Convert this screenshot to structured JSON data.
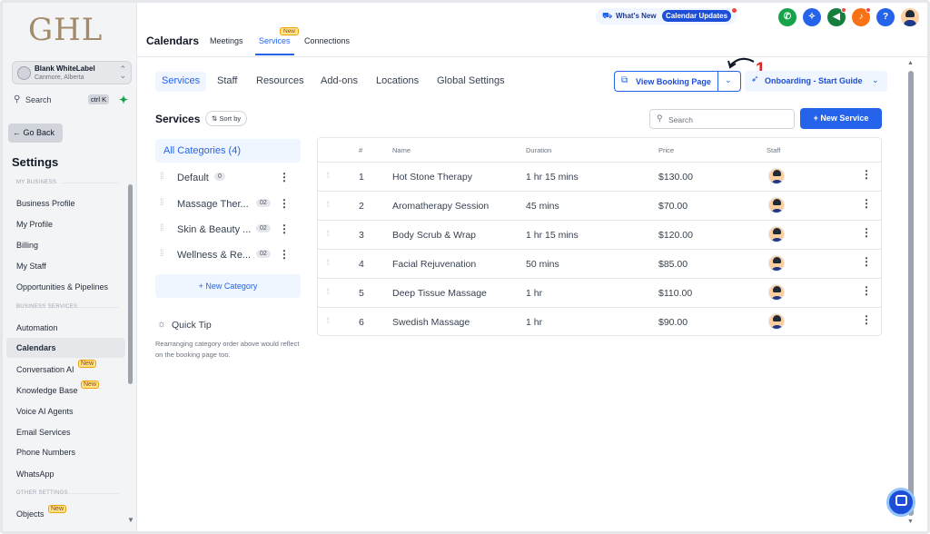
{
  "sidebar": {
    "logo": "GHL",
    "account_name": "Blank WhiteLabel",
    "account_location": "Canmore, Alberta",
    "search_label": "Search",
    "search_shortcut": "ctrl K",
    "go_back": "← Go Back",
    "settings_title": "Settings",
    "section_my_business": "MY BUSINESS",
    "section_business_services": "BUSINESS SERVICES",
    "section_other_settings": "OTHER SETTINGS",
    "items": [
      {
        "label": "Business Profile"
      },
      {
        "label": "My Profile"
      },
      {
        "label": "Billing"
      },
      {
        "label": "My Staff"
      },
      {
        "label": "Opportunities & Pipelines"
      },
      {
        "label": "Automation"
      },
      {
        "label": "Calendars"
      },
      {
        "label": "Conversation AI",
        "badge": "New"
      },
      {
        "label": "Knowledge Base",
        "badge": "New"
      },
      {
        "label": "Voice AI Agents"
      },
      {
        "label": "Email Services"
      },
      {
        "label": "Phone Numbers"
      },
      {
        "label": "WhatsApp"
      },
      {
        "label": "Objects",
        "badge": "New"
      }
    ]
  },
  "topbar": {
    "title": "Calendars",
    "tabs": [
      {
        "label": "Meetings"
      },
      {
        "label": "Services",
        "badge": "New"
      },
      {
        "label": "Connections"
      }
    ],
    "whats_new": "What's New",
    "calendar_updates": "Calendar Updates",
    "icon_colors": {
      "phone": "#16a34a",
      "sparkle": "#2563eb",
      "megaphone": "#15803d",
      "bell": "#f97316",
      "help": "#2563eb"
    }
  },
  "subnav": {
    "tabs": [
      {
        "label": "Services"
      },
      {
        "label": "Staff"
      },
      {
        "label": "Resources"
      },
      {
        "label": "Add-ons"
      },
      {
        "label": "Locations"
      },
      {
        "label": "Global Settings"
      }
    ]
  },
  "actions": {
    "view_booking_page": "View Booking Page",
    "onboarding": "Onboarding - Start Guide",
    "annotation_number": "1"
  },
  "services": {
    "title": "Services",
    "sort_by": "⇅ Sort by",
    "search_placeholder": "Search",
    "new_service": "+ New Service"
  },
  "categories": {
    "all": "All Categories (4)",
    "items": [
      {
        "name": "Default",
        "count": "0"
      },
      {
        "name": "Massage Ther...",
        "count": "02"
      },
      {
        "name": "Skin & Beauty ...",
        "count": "02"
      },
      {
        "name": "Wellness & Re...",
        "count": "02"
      }
    ],
    "new_category": "+ New Category",
    "quick_tip_title": "Quick Tip",
    "quick_tip_text": "Rearranging category order above would reflect on the booking page too."
  },
  "table": {
    "headers": {
      "num": "#",
      "name": "Name",
      "duration": "Duration",
      "price": "Price",
      "staff": "Staff"
    },
    "rows": [
      {
        "num": "1",
        "name": "Hot Stone Therapy",
        "duration": "1 hr 15 mins",
        "price": "$130.00"
      },
      {
        "num": "2",
        "name": "Aromatherapy Session",
        "duration": "45 mins",
        "price": "$70.00"
      },
      {
        "num": "3",
        "name": "Body Scrub & Wrap",
        "duration": "1 hr 15 mins",
        "price": "$120.00"
      },
      {
        "num": "4",
        "name": "Facial Rejuvenation",
        "duration": "50 mins",
        "price": "$85.00"
      },
      {
        "num": "5",
        "name": "Deep Tissue Massage",
        "duration": "1 hr",
        "price": "$110.00"
      },
      {
        "num": "6",
        "name": "Swedish Massage",
        "duration": "1 hr",
        "price": "$90.00"
      }
    ]
  },
  "colors": {
    "accent": "#2563eb",
    "annotation": "#dc2626"
  }
}
